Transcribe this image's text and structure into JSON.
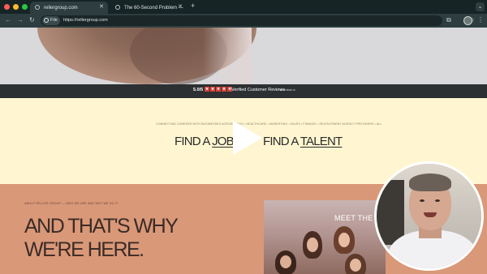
{
  "browser": {
    "tabs": [
      {
        "title": "rellergroup.com",
        "active": true
      },
      {
        "title": "The 60-Second Problem — ⁣",
        "active": false
      }
    ],
    "new_tab_label": "+",
    "tab_menu_label": "⌄",
    "toolbar": {
      "back": "←",
      "forward": "→",
      "reload": "↻",
      "file_chip": "File",
      "url": "https://rellergroup.com",
      "bookmark": "☆",
      "extensions": "⧉",
      "menu": "⋮"
    },
    "colors": {
      "red": "#ff5f57",
      "yellow": "#febc2e",
      "green": "#28c840",
      "chrome": "#2e3e40"
    }
  },
  "page": {
    "reviews": {
      "score": "5.0/5",
      "stars": [
        "★",
        "★",
        "★",
        "★",
        "★"
      ],
      "label": "Verified Customer Reviews",
      "logo": "■ reviews.io"
    },
    "ticker": "CONNECTING CAREERS WITH BUSINESSES ACROSS TECH • HEALTHCARE • MARKETING • SALES • FINANCE • RECRUITMENT AGENCY PROVIDERS • ALL",
    "find_job": {
      "prefix": "FIND A ",
      "emphasis": "JOB"
    },
    "find_talent": {
      "prefix": "FIND A ",
      "emphasis": "TALENT"
    },
    "about_label": "ABOUT RELLER GROUP — WHO WE ARE AND WHY WE DO IT",
    "headline_line1": "AND THAT'S WHY",
    "headline_line2": "WE'RE HERE.",
    "team_photo_title": "MEET THE TE",
    "colors": {
      "yellow_band": "#fff6d1",
      "salmon_band": "#d99878",
      "review_star": "#d9453b"
    }
  },
  "presenter": {
    "icon": "webcam-presenter"
  }
}
